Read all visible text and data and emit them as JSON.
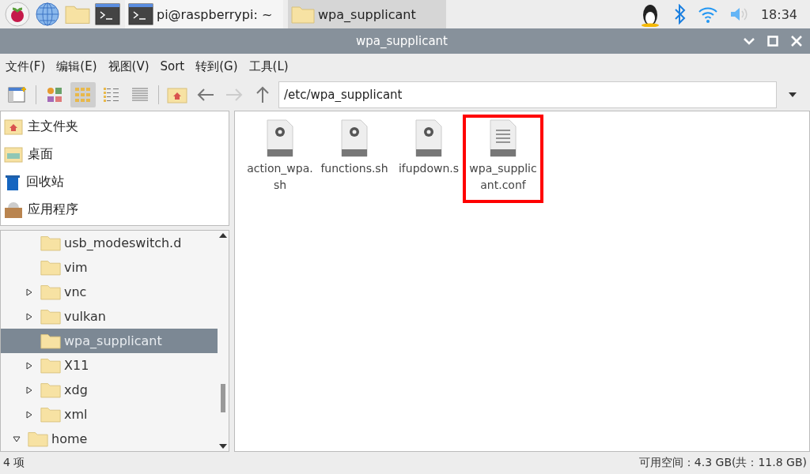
{
  "taskbar": {
    "tasks": [
      {
        "label": "pi@raspberrypi: ~",
        "kind": "terminal",
        "selected": false
      },
      {
        "label": "wpa_supplicant",
        "kind": "folder",
        "selected": true
      }
    ],
    "clock": "18:34"
  },
  "window": {
    "title": "wpa_supplicant"
  },
  "menu": [
    "文件(F)",
    "编辑(E)",
    "视图(V)",
    "Sort",
    "转到(G)",
    "工具(L)"
  ],
  "toolbar": {
    "view_modes": [
      {
        "kind": "thumbnails",
        "selected": false
      },
      {
        "kind": "icons",
        "selected": true
      },
      {
        "kind": "compact",
        "selected": false
      },
      {
        "kind": "list",
        "selected": false
      }
    ],
    "path": "/etc/wpa_supplicant"
  },
  "places": [
    {
      "label": "主文件夹",
      "kind": "home"
    },
    {
      "label": "桌面",
      "kind": "desktop"
    },
    {
      "label": "回收站",
      "kind": "trash"
    },
    {
      "label": "应用程序",
      "kind": "apps"
    }
  ],
  "tree": [
    {
      "children": [
        {
          "label": "usb_modeswitch.d",
          "selected": false
        },
        {
          "label": "vim",
          "selected": false
        },
        {
          "label": "vnc",
          "expanded": false,
          "selected": false
        },
        {
          "label": "vulkan",
          "expanded": false,
          "selected": false
        },
        {
          "label": "wpa_supplicant",
          "selected": true
        },
        {
          "label": "X11",
          "expanded": false,
          "selected": false
        },
        {
          "label": "xdg",
          "expanded": false,
          "selected": false
        },
        {
          "label": "xml",
          "expanded": false,
          "selected": false
        }
      ]
    },
    {
      "label": "home",
      "expanded": true,
      "selected": false
    }
  ],
  "files": [
    {
      "name": "action_wpa.sh",
      "kind": "script",
      "highlighted": false
    },
    {
      "name": "functions.sh",
      "kind": "script",
      "highlighted": false
    },
    {
      "name": "ifupdown.s",
      "kind": "script",
      "highlighted": false
    },
    {
      "name": "wpa_supplicant.conf",
      "kind": "text",
      "highlighted": true
    }
  ],
  "status_bar": {
    "count": "4 项",
    "free_space": "可用空间：4.3 GB(共：11.8 GB)"
  }
}
